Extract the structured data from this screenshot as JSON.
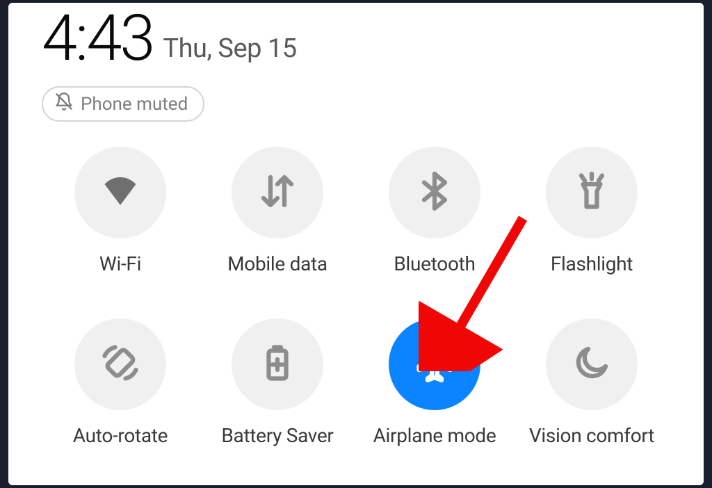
{
  "header": {
    "time": "4:43",
    "date": "Thu, Sep 15"
  },
  "status": {
    "mute_label": "Phone muted"
  },
  "tiles": [
    {
      "id": "wifi",
      "label": "Wi-Fi",
      "active": false
    },
    {
      "id": "mobile-data",
      "label": "Mobile data",
      "active": false
    },
    {
      "id": "bluetooth",
      "label": "Bluetooth",
      "active": false
    },
    {
      "id": "flashlight",
      "label": "Flashlight",
      "active": false
    },
    {
      "id": "auto-rotate",
      "label": "Auto-rotate",
      "active": false
    },
    {
      "id": "battery-saver",
      "label": "Battery Saver",
      "active": false
    },
    {
      "id": "airplane-mode",
      "label": "Airplane mode",
      "active": true
    },
    {
      "id": "vision-comfort",
      "label": "Vision comfort",
      "active": false
    }
  ],
  "annotation": {
    "points_to": "airplane-mode",
    "color": "#f10606"
  }
}
